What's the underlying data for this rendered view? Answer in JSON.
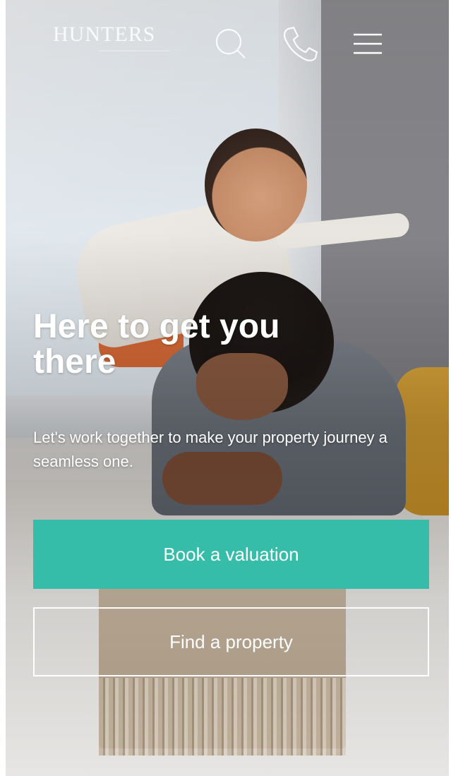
{
  "header": {
    "logo_text": "HUNTERS",
    "icons": [
      "search-icon",
      "phone-icon",
      "menu-icon"
    ]
  },
  "hero": {
    "headline": "Here to get you there",
    "subtext": "Let's work together to make your property journey a seamless one.",
    "primary_button": "Book a valuation",
    "secondary_button": "Find a property"
  },
  "colors": {
    "accent": "#36bda9",
    "text": "#ffffff"
  }
}
